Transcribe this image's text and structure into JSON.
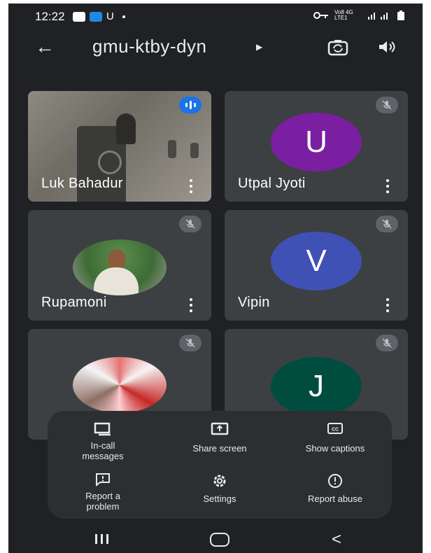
{
  "status_bar": {
    "time": "12:22",
    "carrier_letter": "U",
    "network_label": "Vo8 4G LTE1",
    "icons": [
      "screen-record-icon",
      "app-notification-icon",
      "key-icon",
      "signal-icon",
      "battery-icon"
    ]
  },
  "app_bar": {
    "meeting_code": "gmu-ktby-dyn",
    "icons": [
      "back-arrow-icon",
      "caret-right-icon",
      "switch-camera-icon",
      "speaker-icon"
    ]
  },
  "participants": [
    {
      "name": "Luk Bahadur",
      "type": "video",
      "speaking": true
    },
    {
      "name": "Utpal Jyoti",
      "type": "letter",
      "initial": "U",
      "color": "#7b1fa2",
      "muted": true
    },
    {
      "name": "Rupamoni",
      "type": "photo",
      "muted": true
    },
    {
      "name": "Vipin",
      "type": "letter",
      "initial": "V",
      "color": "#3f51b5",
      "muted": true
    },
    {
      "name": "",
      "type": "photo",
      "muted": true
    },
    {
      "name": "",
      "type": "letter",
      "initial": "J",
      "color": "#004d40",
      "muted": true
    }
  ],
  "menu": {
    "items": [
      {
        "label": "In-call\nmessages",
        "icon": "chat-icon"
      },
      {
        "label": "Share screen",
        "icon": "share-screen-icon"
      },
      {
        "label": "Show captions",
        "icon": "captions-icon"
      },
      {
        "label": "Report a\nproblem",
        "icon": "feedback-icon"
      },
      {
        "label": "Settings",
        "icon": "settings-icon"
      },
      {
        "label": "Report abuse",
        "icon": "report-icon"
      }
    ]
  },
  "nav_bar": {
    "icons": [
      "recents-icon",
      "home-icon",
      "back-icon"
    ]
  }
}
